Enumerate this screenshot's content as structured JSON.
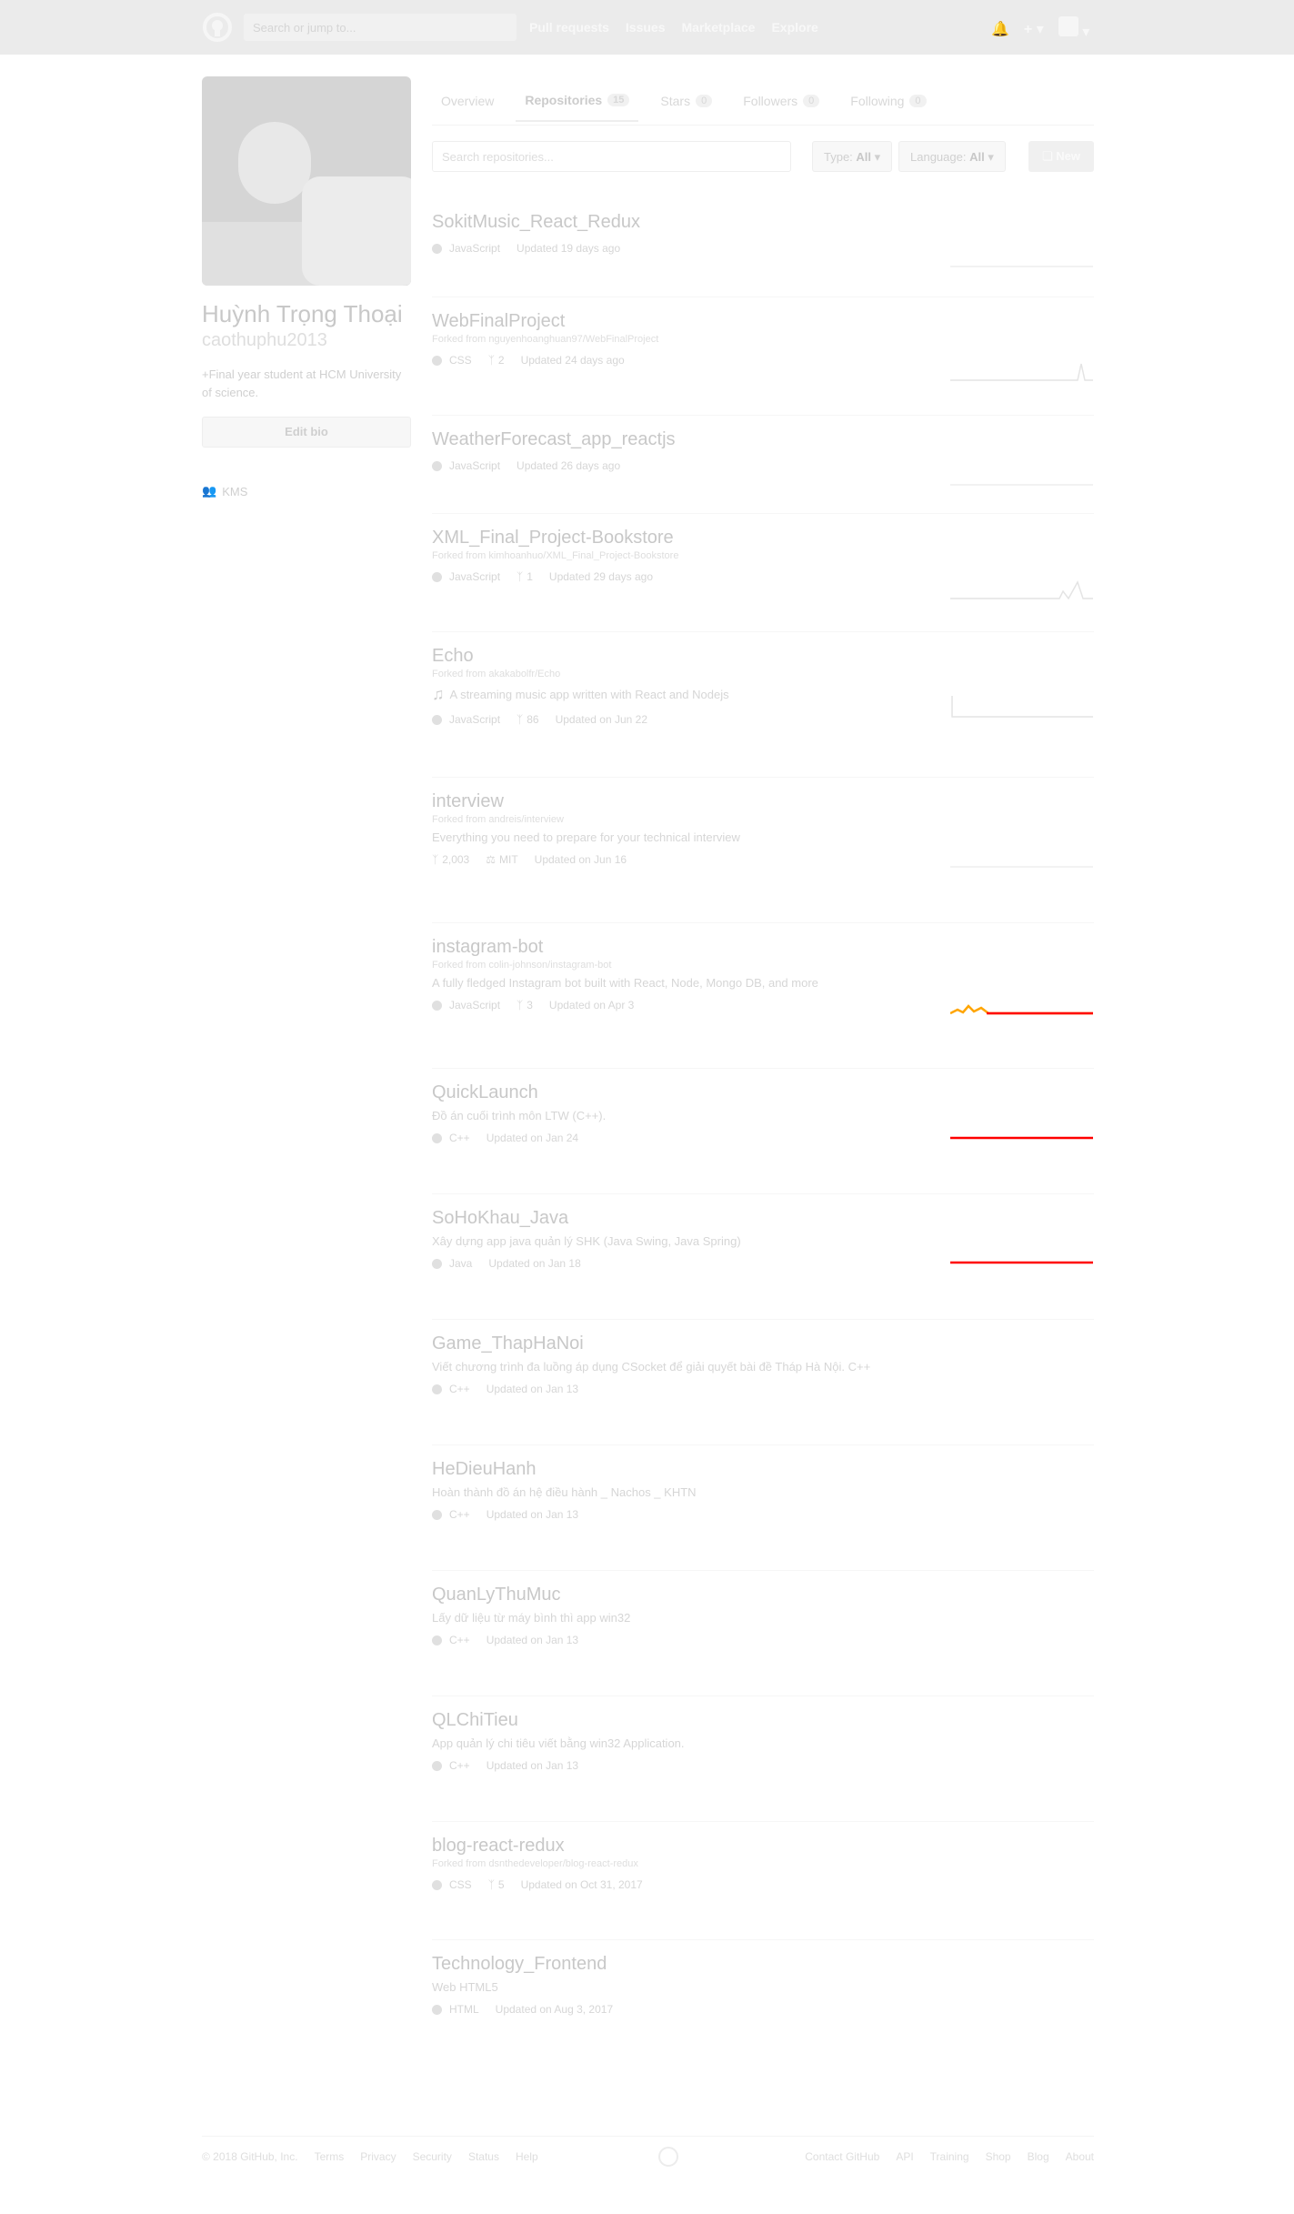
{
  "header": {
    "search_placeholder": "Search or jump to...",
    "nav": [
      "Pull requests",
      "Issues",
      "Marketplace",
      "Explore"
    ],
    "icons": [
      "bell-icon",
      "plus-icon",
      "avatar-menu"
    ]
  },
  "profile": {
    "fullname": "Huỳnh Trọng Thoại",
    "username": "caothuphu2013",
    "bio": "+Final year student at HCM University of science.",
    "edit_bio": "Edit bio",
    "org": "KMS"
  },
  "tabs": [
    {
      "label": "Overview",
      "count": ""
    },
    {
      "label": "Repositories",
      "count": "15"
    },
    {
      "label": "Stars",
      "count": "0"
    },
    {
      "label": "Followers",
      "count": "0"
    },
    {
      "label": "Following",
      "count": "0"
    }
  ],
  "filters": {
    "search_placeholder": "Search repositories...",
    "type_label": "Type:",
    "type_value": "All",
    "language_label": "Language:",
    "language_value": "All",
    "new_button": "New"
  },
  "repos": [
    {
      "name": "SokitMusic_React_Redux",
      "fork": "",
      "desc": "",
      "lang": "JavaScript",
      "forks": "",
      "license": "",
      "updated": "Updated 19 days ago"
    },
    {
      "name": "WebFinalProject",
      "fork": "Forked from nguyenhoanghuan97/WebFinalProject",
      "desc": "",
      "lang": "CSS",
      "forks": "2",
      "license": "",
      "updated": "Updated 24 days ago"
    },
    {
      "name": "WeatherForecast_app_reactjs",
      "fork": "",
      "desc": "",
      "lang": "JavaScript",
      "forks": "",
      "license": "",
      "updated": "Updated 26 days ago"
    },
    {
      "name": "XML_Final_Project-Bookstore",
      "fork": "Forked from kimhoanhuo/XML_Final_Project-Bookstore",
      "desc": "",
      "lang": "JavaScript",
      "forks": "1",
      "license": "",
      "updated": "Updated 29 days ago"
    },
    {
      "name": "Echo",
      "fork": "Forked from akakabolfr/Echo",
      "desc": "A streaming music app written with React and Nodejs",
      "lang": "JavaScript",
      "forks": "86",
      "license": "",
      "updated": "Updated on Jun 22"
    },
    {
      "name": "interview",
      "fork": "Forked from andreis/interview",
      "desc": "Everything you need to prepare for your technical interview",
      "lang": "",
      "forks": "2,003",
      "license": "MIT",
      "updated": "Updated on Jun 16"
    },
    {
      "name": "instagram-bot",
      "fork": "Forked from colin-johnson/instagram-bot",
      "desc": "A fully fledged Instagram bot built with React, Node, Mongo DB, and more",
      "lang": "JavaScript",
      "forks": "3",
      "license": "",
      "updated": "Updated on Apr 3"
    },
    {
      "name": "QuickLaunch",
      "fork": "",
      "desc": "Đồ án cuối trình môn LTW (C++).",
      "lang": "C++",
      "forks": "",
      "license": "",
      "updated": "Updated on Jan 24"
    },
    {
      "name": "SoHoKhau_Java",
      "fork": "",
      "desc": "Xây dựng app java quản lý SHK (Java Swing, Java Spring)",
      "lang": "Java",
      "forks": "",
      "license": "",
      "updated": "Updated on Jan 18"
    },
    {
      "name": "Game_ThapHaNoi",
      "fork": "",
      "desc": "Viết chương trình đa luồng áp dụng CSocket để giải quyết bài đề Tháp Hà Nội. C++",
      "lang": "C++",
      "forks": "",
      "license": "",
      "updated": "Updated on Jan 13"
    },
    {
      "name": "HeDieuHanh",
      "fork": "",
      "desc": "Hoàn thành đồ án hệ điều hành _ Nachos _ KHTN",
      "lang": "C++",
      "forks": "",
      "license": "",
      "updated": "Updated on Jan 13"
    },
    {
      "name": "QuanLyThuMuc",
      "fork": "",
      "desc": "Lấy dữ liệu từ máy bình thì app win32",
      "lang": "C++",
      "forks": "",
      "license": "",
      "updated": "Updated on Jan 13"
    },
    {
      "name": "QLChiTieu",
      "fork": "",
      "desc": "App quản lý chi tiêu viết bằng win32 Application.",
      "lang": "C++",
      "forks": "",
      "license": "",
      "updated": "Updated on Jan 13"
    },
    {
      "name": "blog-react-redux",
      "fork": "Forked from dsnthedeveloper/blog-react-redux",
      "desc": "",
      "lang": "CSS",
      "forks": "5",
      "license": "",
      "updated": "Updated on Oct 31, 2017"
    },
    {
      "name": "Technology_Frontend",
      "fork": "",
      "desc": "Web HTML5",
      "lang": "HTML",
      "forks": "",
      "license": "",
      "updated": "Updated on Aug 3, 2017"
    }
  ],
  "footer": {
    "left": [
      "© 2018 GitHub, Inc.",
      "Terms",
      "Privacy",
      "Security",
      "Status",
      "Help"
    ],
    "right": [
      "Contact GitHub",
      "API",
      "Training",
      "Shop",
      "Blog",
      "About"
    ]
  },
  "colors": {
    "spark_red": "#ff0000",
    "spark_orange": "#ffa500",
    "spark_faint": "#eeeeee"
  }
}
